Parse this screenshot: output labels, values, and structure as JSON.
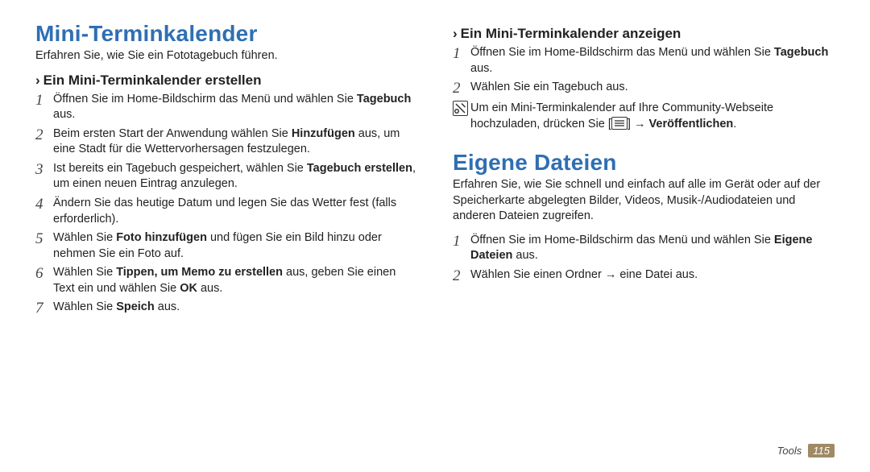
{
  "left": {
    "title": "Mini-Terminkalender",
    "intro": "Erfahren Sie, wie Sie ein Fototagebuch führen.",
    "sub": "Ein Mini-Terminkalender erstellen",
    "steps": [
      {
        "n": "1",
        "pre": "Öffnen Sie im Home-Bildschirm das Menü und wählen Sie ",
        "bold": "Tagebuch",
        "post": " aus."
      },
      {
        "n": "2",
        "pre": "Beim ersten Start der Anwendung wählen Sie ",
        "bold": "Hinzufügen",
        "post": " aus, um eine Stadt für die Wettervorhersagen festzulegen."
      },
      {
        "n": "3",
        "pre": "Ist bereits ein Tagebuch gespeichert, wählen Sie ",
        "bold": "Tagebuch erstellen",
        "post": ", um einen neuen Eintrag anzulegen."
      },
      {
        "n": "4",
        "pre": "Ändern Sie das heutige Datum und legen Sie das Wetter fest (falls erforderlich).",
        "bold": "",
        "post": ""
      },
      {
        "n": "5",
        "pre": "Wählen Sie ",
        "bold": "Foto hinzufügen",
        "post": " und fügen Sie ein Bild hinzu oder nehmen Sie ein Foto auf."
      },
      {
        "n": "6",
        "pre": "Wählen Sie ",
        "bold": "Tippen, um Memo zu erstellen",
        "post": " aus, geben Sie einen Text ein und wählen Sie ",
        "bold2": "OK",
        "post2": " aus."
      },
      {
        "n": "7",
        "pre": "Wählen Sie ",
        "bold": "Speich",
        "post": " aus."
      }
    ]
  },
  "right": {
    "sub1": "Ein Mini-Terminkalender anzeigen",
    "s1": {
      "n": "1",
      "pre": "Öffnen Sie im Home-Bildschirm das Menü und wählen Sie ",
      "bold": "Tagebuch",
      "post": " aus."
    },
    "s2": {
      "n": "2",
      "text": "Wählen Sie ein Tagebuch aus."
    },
    "note": {
      "pre": "Um ein Mini-Terminkalender auf Ihre Community-Webseite hochzuladen, drücken Sie [",
      "mid": "] → ",
      "bold": "Veröffentlichen",
      "post": "."
    },
    "title": "Eigene Dateien",
    "intro": "Erfahren Sie, wie Sie schnell und einfach auf alle im Gerät oder auf der Speicherkarte abgelegten Bilder, Videos, Musik-/Audiodateien und anderen Dateien zugreifen.",
    "f1": {
      "n": "1",
      "pre": "Öffnen Sie im Home-Bildschirm das Menü und wählen Sie ",
      "bold": "Eigene Dateien",
      "post": " aus."
    },
    "f2": {
      "n": "2",
      "text": "Wählen Sie einen Ordner → eine Datei aus."
    }
  },
  "footer": {
    "label": "Tools",
    "page": "115"
  }
}
